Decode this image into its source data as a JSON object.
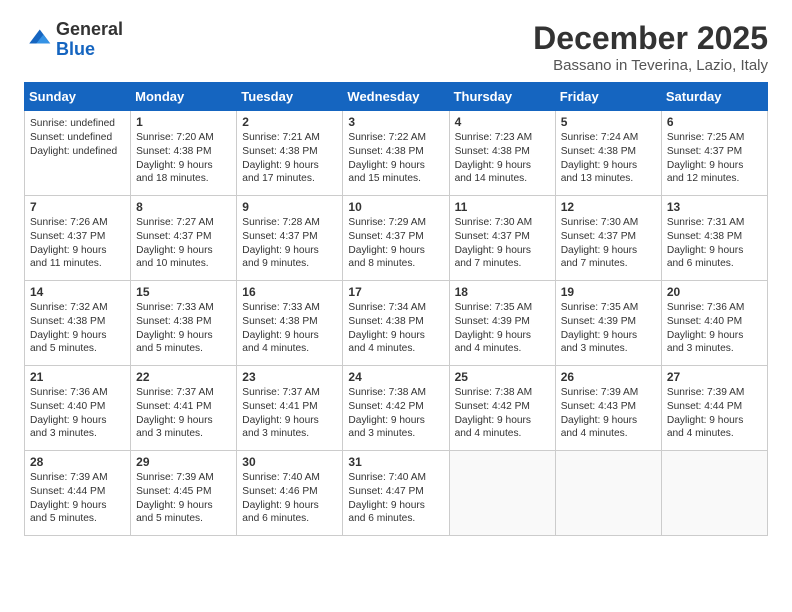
{
  "logo": {
    "general": "General",
    "blue": "Blue"
  },
  "header": {
    "month": "December 2025",
    "location": "Bassano in Teverina, Lazio, Italy"
  },
  "weekdays": [
    "Sunday",
    "Monday",
    "Tuesday",
    "Wednesday",
    "Thursday",
    "Friday",
    "Saturday"
  ],
  "weeks": [
    [
      {
        "day": null,
        "content": null
      },
      {
        "day": "1",
        "sunrise": "7:20 AM",
        "sunset": "4:38 PM",
        "daylight": "9 hours and 18 minutes."
      },
      {
        "day": "2",
        "sunrise": "7:21 AM",
        "sunset": "4:38 PM",
        "daylight": "9 hours and 17 minutes."
      },
      {
        "day": "3",
        "sunrise": "7:22 AM",
        "sunset": "4:38 PM",
        "daylight": "9 hours and 15 minutes."
      },
      {
        "day": "4",
        "sunrise": "7:23 AM",
        "sunset": "4:38 PM",
        "daylight": "9 hours and 14 minutes."
      },
      {
        "day": "5",
        "sunrise": "7:24 AM",
        "sunset": "4:38 PM",
        "daylight": "9 hours and 13 minutes."
      },
      {
        "day": "6",
        "sunrise": "7:25 AM",
        "sunset": "4:37 PM",
        "daylight": "9 hours and 12 minutes."
      }
    ],
    [
      {
        "day": "7",
        "sunrise": "7:26 AM",
        "sunset": "4:37 PM",
        "daylight": "9 hours and 11 minutes."
      },
      {
        "day": "8",
        "sunrise": "7:27 AM",
        "sunset": "4:37 PM",
        "daylight": "9 hours and 10 minutes."
      },
      {
        "day": "9",
        "sunrise": "7:28 AM",
        "sunset": "4:37 PM",
        "daylight": "9 hours and 9 minutes."
      },
      {
        "day": "10",
        "sunrise": "7:29 AM",
        "sunset": "4:37 PM",
        "daylight": "9 hours and 8 minutes."
      },
      {
        "day": "11",
        "sunrise": "7:30 AM",
        "sunset": "4:37 PM",
        "daylight": "9 hours and 7 minutes."
      },
      {
        "day": "12",
        "sunrise": "7:30 AM",
        "sunset": "4:37 PM",
        "daylight": "9 hours and 7 minutes."
      },
      {
        "day": "13",
        "sunrise": "7:31 AM",
        "sunset": "4:38 PM",
        "daylight": "9 hours and 6 minutes."
      }
    ],
    [
      {
        "day": "14",
        "sunrise": "7:32 AM",
        "sunset": "4:38 PM",
        "daylight": "9 hours and 5 minutes."
      },
      {
        "day": "15",
        "sunrise": "7:33 AM",
        "sunset": "4:38 PM",
        "daylight": "9 hours and 5 minutes."
      },
      {
        "day": "16",
        "sunrise": "7:33 AM",
        "sunset": "4:38 PM",
        "daylight": "9 hours and 4 minutes."
      },
      {
        "day": "17",
        "sunrise": "7:34 AM",
        "sunset": "4:38 PM",
        "daylight": "9 hours and 4 minutes."
      },
      {
        "day": "18",
        "sunrise": "7:35 AM",
        "sunset": "4:39 PM",
        "daylight": "9 hours and 4 minutes."
      },
      {
        "day": "19",
        "sunrise": "7:35 AM",
        "sunset": "4:39 PM",
        "daylight": "9 hours and 3 minutes."
      },
      {
        "day": "20",
        "sunrise": "7:36 AM",
        "sunset": "4:40 PM",
        "daylight": "9 hours and 3 minutes."
      }
    ],
    [
      {
        "day": "21",
        "sunrise": "7:36 AM",
        "sunset": "4:40 PM",
        "daylight": "9 hours and 3 minutes."
      },
      {
        "day": "22",
        "sunrise": "7:37 AM",
        "sunset": "4:41 PM",
        "daylight": "9 hours and 3 minutes."
      },
      {
        "day": "23",
        "sunrise": "7:37 AM",
        "sunset": "4:41 PM",
        "daylight": "9 hours and 3 minutes."
      },
      {
        "day": "24",
        "sunrise": "7:38 AM",
        "sunset": "4:42 PM",
        "daylight": "9 hours and 3 minutes."
      },
      {
        "day": "25",
        "sunrise": "7:38 AM",
        "sunset": "4:42 PM",
        "daylight": "9 hours and 4 minutes."
      },
      {
        "day": "26",
        "sunrise": "7:39 AM",
        "sunset": "4:43 PM",
        "daylight": "9 hours and 4 minutes."
      },
      {
        "day": "27",
        "sunrise": "7:39 AM",
        "sunset": "4:44 PM",
        "daylight": "9 hours and 4 minutes."
      }
    ],
    [
      {
        "day": "28",
        "sunrise": "7:39 AM",
        "sunset": "4:44 PM",
        "daylight": "9 hours and 5 minutes."
      },
      {
        "day": "29",
        "sunrise": "7:39 AM",
        "sunset": "4:45 PM",
        "daylight": "9 hours and 5 minutes."
      },
      {
        "day": "30",
        "sunrise": "7:40 AM",
        "sunset": "4:46 PM",
        "daylight": "9 hours and 6 minutes."
      },
      {
        "day": "31",
        "sunrise": "7:40 AM",
        "sunset": "4:47 PM",
        "daylight": "9 hours and 6 minutes."
      },
      null,
      null,
      null
    ]
  ]
}
